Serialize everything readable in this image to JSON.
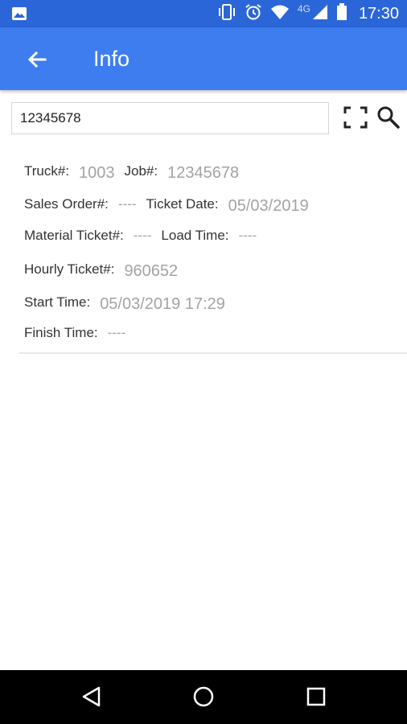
{
  "status_bar": {
    "time": "17:30",
    "network": "4G",
    "icons": [
      "image-icon",
      "vibrate-icon",
      "alarm-icon",
      "wifi-icon",
      "signal-icon",
      "battery-icon"
    ]
  },
  "app_bar": {
    "title": "Info",
    "back_icon": "arrow-left-icon",
    "color": "#3d7df0"
  },
  "search": {
    "value": "12345678",
    "scan_icon": "scan-frame-icon",
    "search_icon": "search-icon"
  },
  "info": {
    "truck_label": "Truck#:",
    "truck_value": "1003",
    "job_label": "Job#:",
    "job_value": "12345678",
    "sales_order_label": "Sales Order#:",
    "sales_order_value": "----",
    "ticket_date_label": "Ticket Date:",
    "ticket_date_value": "05/03/2019",
    "material_ticket_label": "Material Ticket#:",
    "material_ticket_value": "----",
    "load_time_label": "Load Time:",
    "load_time_value": "----",
    "hourly_ticket_label": "Hourly Ticket#:",
    "hourly_ticket_value": "960652",
    "start_time_label": "Start Time:",
    "start_time_value": "05/03/2019 17:29",
    "finish_time_label": "Finish Time:",
    "finish_time_value": "----"
  },
  "nav_bar": {
    "icons": [
      "back-triangle-icon",
      "home-circle-icon",
      "recents-square-icon"
    ]
  }
}
